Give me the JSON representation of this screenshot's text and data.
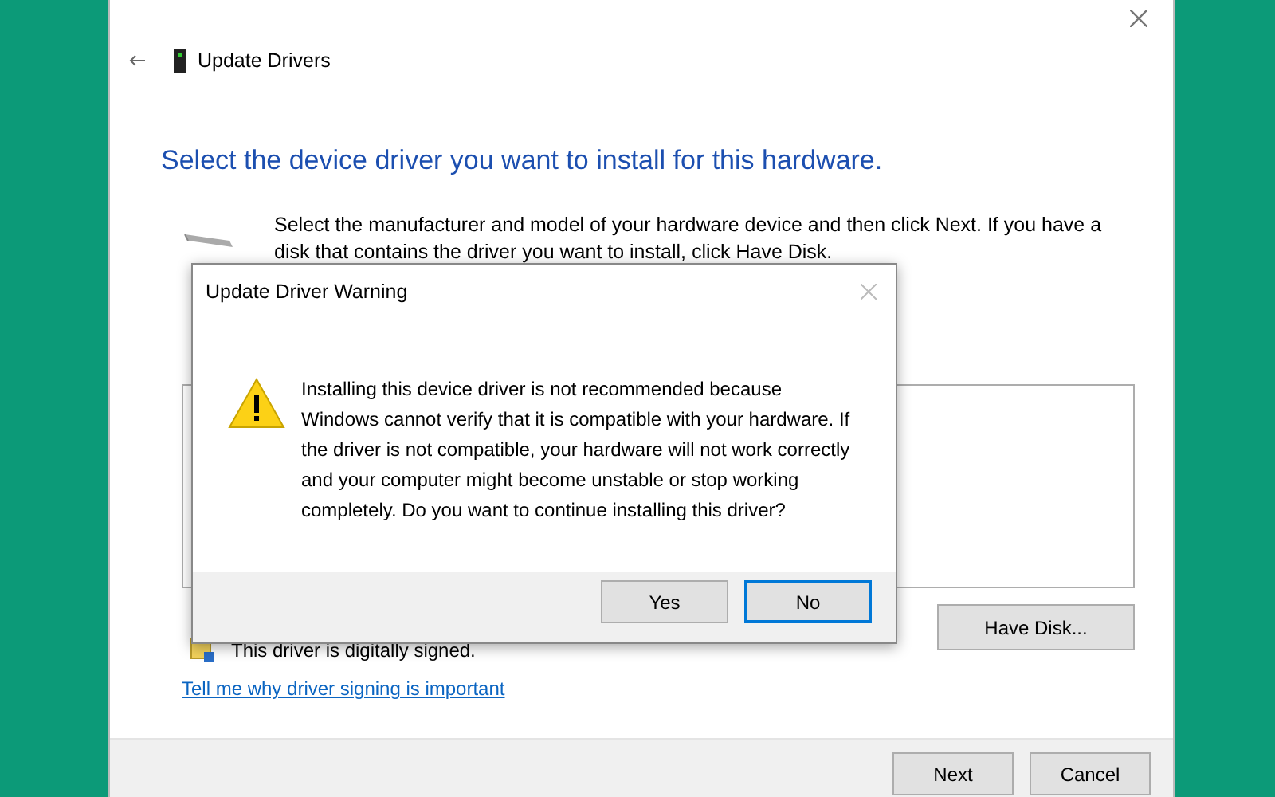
{
  "window": {
    "title": "Update Drivers"
  },
  "heading": "Select the device driver you want to install for this hardware.",
  "instructions": "Select the manufacturer and model of your hardware device and then click Next. If you have a disk that contains the driver you want to install, click Have Disk.",
  "signed_note": "This driver is digitally signed.",
  "signing_link": "Tell me why driver signing is important",
  "have_disk_button": "Have Disk...",
  "buttons": [
    {
      "label": "Next"
    },
    {
      "label": "Cancel"
    }
  ],
  "dialog": {
    "title": "Update Driver Warning",
    "message": "Installing this device driver is not recommended because Windows cannot verify that it is compatible with your hardware.  If the driver is not compatible, your hardware will not work correctly and your computer might become unstable or stop working completely.  Do you want to continue installing this driver?",
    "buttons": [
      {
        "label": "Yes",
        "selected": false
      },
      {
        "label": "No",
        "selected": true
      }
    ]
  }
}
